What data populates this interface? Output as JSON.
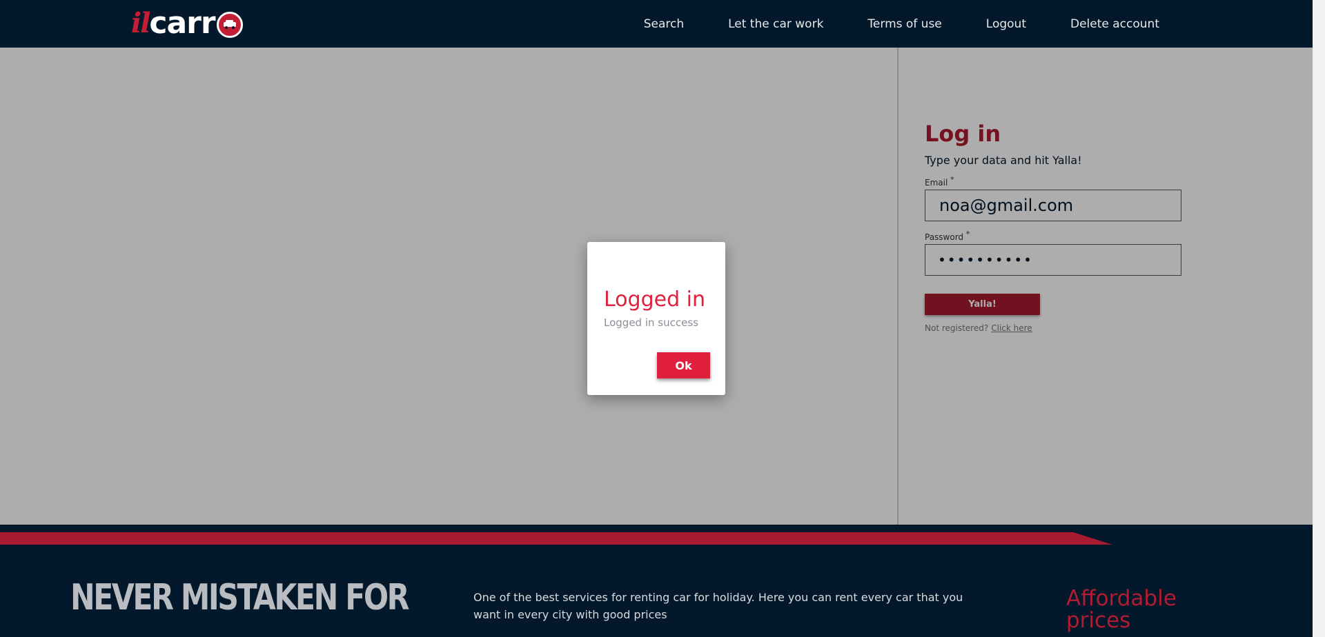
{
  "header": {
    "logo": {
      "part1": "il",
      "part2": "carr"
    },
    "nav": {
      "search": "Search",
      "let_car_work": "Let the car work",
      "terms": "Terms of use",
      "logout": "Logout",
      "delete_account": "Delete account"
    }
  },
  "login": {
    "title": "Log in",
    "subtitle": "Type your data and hit Yalla!",
    "email_label": "Email",
    "email_value": "noa@gmail.com",
    "password_label": "Password",
    "password_value": "••••••••••",
    "required_mark": "*",
    "submit_label": "Yalla!",
    "not_registered": "Not registered?",
    "click_here": "Click here"
  },
  "footer": {
    "slogan": "NEVER MISTAKEN FOR",
    "description": "One of the best services for renting car for holiday. Here you can rent every car that you want in every city with good prices",
    "feature": "Affordable prices"
  },
  "dialog": {
    "title": "Logged in",
    "message": "Logged in success",
    "ok_label": "Ok"
  },
  "colors": {
    "brand_dark": "#03192b",
    "brand_red": "#a81a2f",
    "accent_red": "#e0203c"
  }
}
